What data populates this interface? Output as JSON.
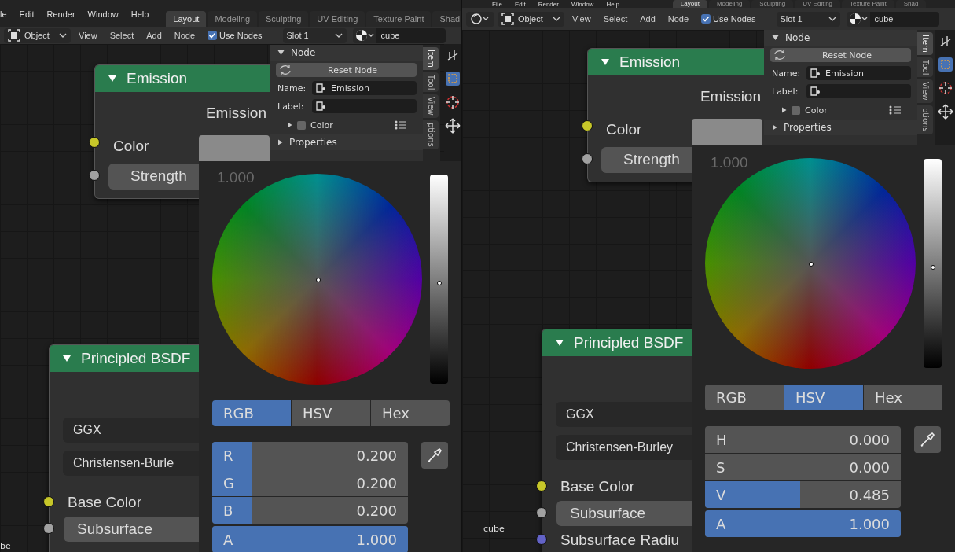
{
  "panels": [
    {
      "menu": [
        "le",
        "Edit",
        "Render",
        "Window",
        "Help"
      ],
      "workspaces": [
        {
          "label": "Layout",
          "selected": true
        },
        {
          "label": "Modeling",
          "selected": false
        },
        {
          "label": "Sculpting",
          "selected": false
        },
        {
          "label": "UV Editing",
          "selected": false
        },
        {
          "label": "Texture Paint",
          "selected": false
        },
        {
          "label": "Shad",
          "selected": false
        }
      ],
      "header": {
        "editor_type_menu": false,
        "mode": "Object",
        "menus": [
          "View",
          "Select",
          "Add",
          "Node"
        ],
        "use_nodes": {
          "label": "Use Nodes",
          "checked": true
        },
        "slot": "Slot 1",
        "material": "cube"
      },
      "sidebar": {
        "panel": "Node",
        "reset": "Reset Node",
        "name_label": "Name:",
        "name_value": "Emission",
        "label_label": "Label:",
        "color_label": "Color",
        "color_enabled": false,
        "properties": "Properties",
        "tabs": [
          {
            "label": "Item",
            "selected": true
          },
          {
            "label": "Tool",
            "selected": false
          },
          {
            "label": "View",
            "selected": false
          },
          {
            "label": "ptions",
            "selected": false
          }
        ]
      },
      "emission_node": {
        "title": "Emission",
        "output": "Emission",
        "color_input": {
          "label": "Color",
          "color": "#c7c729"
        },
        "strength": {
          "label": "Strength",
          "value": "1.000",
          "color": "#a1a1a1"
        }
      },
      "picker": {
        "value_slider": {
          "level": 0.48
        },
        "modes": [
          {
            "label": "RGB",
            "selected": true
          },
          {
            "label": "HSV",
            "selected": false
          },
          {
            "label": "Hex",
            "selected": false
          }
        ],
        "fields": [
          {
            "label": "R",
            "value": "0.200",
            "level": 0.2
          },
          {
            "label": "G",
            "value": "0.200",
            "level": 0.2
          },
          {
            "label": "B",
            "value": "0.200",
            "level": 0.2
          },
          {
            "label": "A",
            "value": "1.000",
            "level": 1
          }
        ]
      },
      "bsdf": {
        "title": "Principled BSDF",
        "distribution": "GGX",
        "subsurface_method": "Christensen-Burle",
        "inputs": [
          {
            "kind": "socket",
            "label": "Base Color",
            "color": "#c7c729"
          },
          {
            "kind": "field",
            "label": "Subsurface",
            "color": "#a1a1a1"
          }
        ]
      },
      "object_label": "be"
    },
    {
      "menu": [
        "File",
        "Edit",
        "Render",
        "Window",
        "Help"
      ],
      "workspaces": [
        {
          "label": "Layout",
          "selected": true
        },
        {
          "label": "Modeling",
          "selected": false
        },
        {
          "label": "Sculpting",
          "selected": false
        },
        {
          "label": "UV Editing",
          "selected": false
        },
        {
          "label": "Texture Paint",
          "selected": false
        },
        {
          "label": "Shad",
          "selected": false
        }
      ],
      "header": {
        "editor_type_menu": true,
        "mode": "Object",
        "menus": [
          "View",
          "Select",
          "Add",
          "Node"
        ],
        "use_nodes": {
          "label": "Use Nodes",
          "checked": true
        },
        "slot": "Slot 1",
        "material": "cube"
      },
      "sidebar": {
        "panel": "Node",
        "reset": "Reset Node",
        "name_label": "Name:",
        "name_value": "Emission",
        "label_label": "Label:",
        "color_label": "Color",
        "color_enabled": false,
        "properties": "Properties",
        "tabs": [
          {
            "label": "Item",
            "selected": true
          },
          {
            "label": "Tool",
            "selected": false
          },
          {
            "label": "View",
            "selected": false
          },
          {
            "label": "ptions",
            "selected": false
          }
        ]
      },
      "emission_node": {
        "title": "Emission",
        "output": "Emission",
        "color_input": {
          "label": "Color",
          "color": "#c7c729"
        },
        "strength": {
          "label": "Strength",
          "value": "1.000",
          "color": "#a1a1a1"
        }
      },
      "picker": {
        "value_slider": {
          "level": 0.48
        },
        "modes": [
          {
            "label": "RGB",
            "selected": false
          },
          {
            "label": "HSV",
            "selected": true
          },
          {
            "label": "Hex",
            "selected": false
          }
        ],
        "fields": [
          {
            "label": "H",
            "value": "0.000",
            "level": 0
          },
          {
            "label": "S",
            "value": "0.000",
            "level": 0
          },
          {
            "label": "V",
            "value": "0.485",
            "level": 0.485
          },
          {
            "label": "A",
            "value": "1.000",
            "level": 1
          }
        ]
      },
      "bsdf": {
        "title": "Principled BSDF",
        "distribution": "GGX",
        "subsurface_method": "Christensen-Burley",
        "inputs": [
          {
            "kind": "socket",
            "label": "Base Color",
            "color": "#c7c729"
          },
          {
            "kind": "field",
            "label": "Subsurface",
            "color": "#a1a1a1"
          },
          {
            "kind": "socket",
            "label": "Subsurface Radiu",
            "color": "#6363c7"
          }
        ]
      },
      "object_label": "cube"
    }
  ]
}
